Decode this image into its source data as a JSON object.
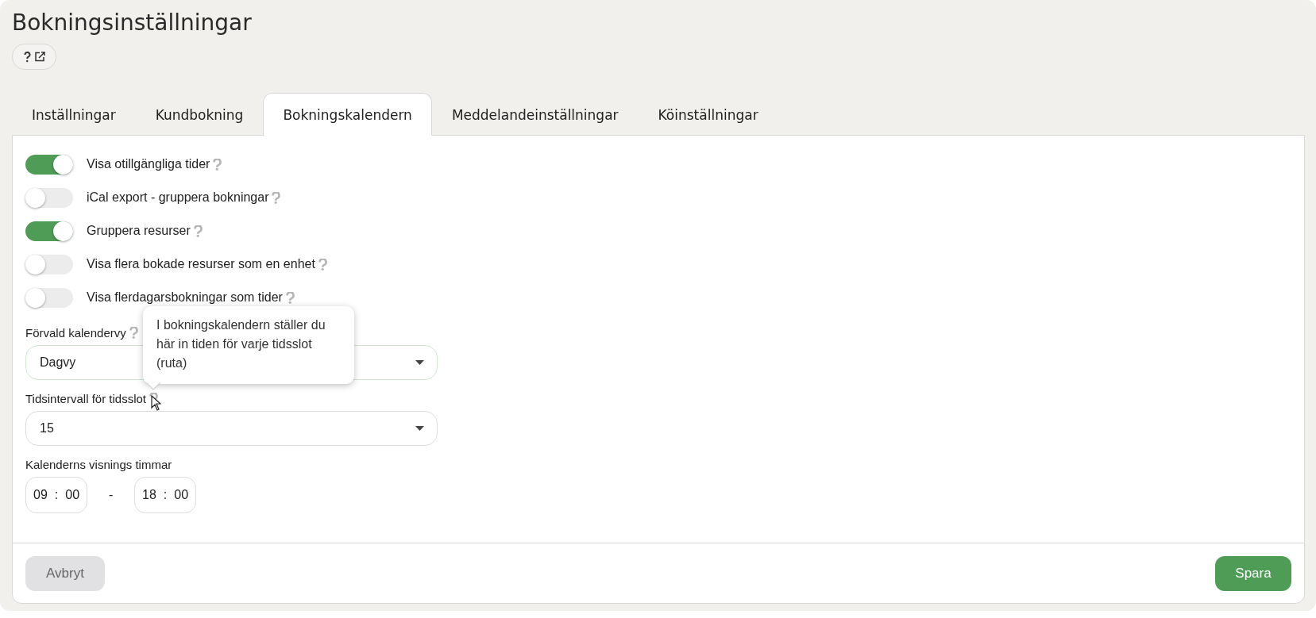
{
  "title": "Bokningsinställningar",
  "tabs": [
    {
      "label": "Inställningar",
      "selected": false
    },
    {
      "label": "Kundbokning",
      "selected": false
    },
    {
      "label": "Bokningskalendern",
      "selected": true
    },
    {
      "label": "Meddelandeinställningar",
      "selected": false
    },
    {
      "label": "Köinställningar",
      "selected": false
    }
  ],
  "toggles": [
    {
      "label": "Visa otillgängliga tider",
      "on": true
    },
    {
      "label": "iCal export - gruppera bokningar",
      "on": false
    },
    {
      "label": "Gruppera resurser",
      "on": true
    },
    {
      "label": "Visa flera bokade resurser som en enhet",
      "on": false
    },
    {
      "label": "Visa flerdagarsbokningar som tider",
      "on": false
    }
  ],
  "selects": [
    {
      "label": "Förvald kalendervy",
      "value": "Dagvy",
      "help": true,
      "focused": true
    },
    {
      "label": "Tidsintervall för tidsslot",
      "value": "15",
      "help": true,
      "focused": false,
      "tooltip": "I bokningskalendern ställer du här in tiden för varje tidsslot (ruta)"
    }
  ],
  "hours": {
    "label": "Kalenderns visnings timmar",
    "from": {
      "hour": "09",
      "sep": ":",
      "minute": "00"
    },
    "dash": "-",
    "to": {
      "hour": "18",
      "sep": ":",
      "minute": "00"
    }
  },
  "buttons": {
    "cancel": "Avbryt",
    "save": "Spara"
  }
}
